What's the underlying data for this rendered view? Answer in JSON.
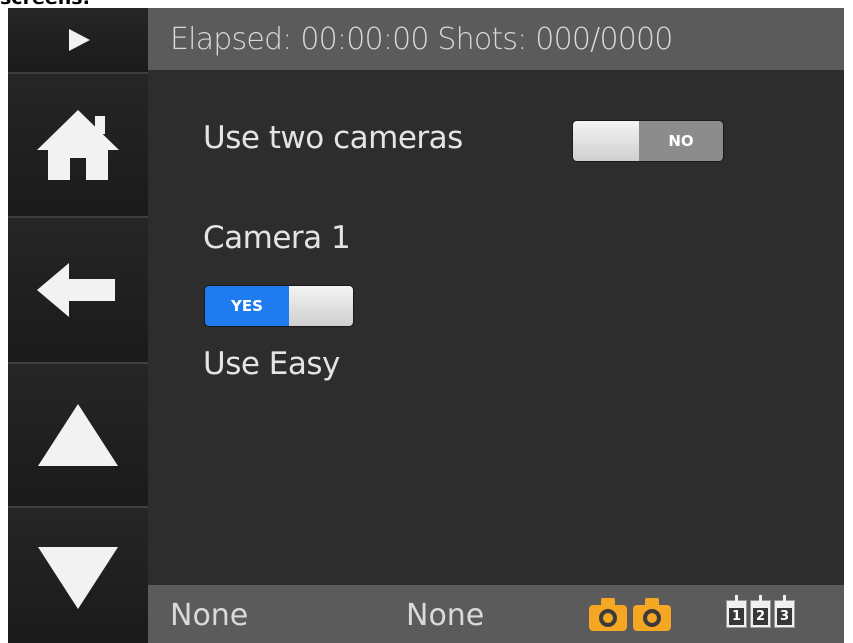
{
  "caption": "screens:",
  "header": {
    "elapsed_label": "Elapsed:",
    "elapsed_value": "00:00:00",
    "shots_label": "Shots:",
    "shots_value": "000/0000"
  },
  "sidebar": {
    "buttons": [
      {
        "name": "play-button",
        "icon": "play-icon"
      },
      {
        "name": "home-button",
        "icon": "home-icon"
      },
      {
        "name": "back-button",
        "icon": "arrow-left-icon"
      },
      {
        "name": "up-button",
        "icon": "arrow-up-icon"
      },
      {
        "name": "down-button",
        "icon": "arrow-down-icon"
      }
    ]
  },
  "settings": {
    "two_cameras": {
      "label": "Use two cameras",
      "state": "NO"
    },
    "camera_heading": "Camera 1",
    "camera_toggle": {
      "state": "YES"
    },
    "easy_label": "Use Easy"
  },
  "footer": {
    "left_value": "None",
    "right_value": "None",
    "camera_icons": [
      "camera-icon",
      "camera-icon"
    ],
    "numbers": [
      "1",
      "2",
      "3"
    ]
  },
  "colors": {
    "toggle_on": "#1e7bf0",
    "toggle_off": "#8c8c8c",
    "camera_icon": "#f5a623",
    "bar_bg": "#5b5b5b",
    "screen_bg": "#2d2d2d"
  }
}
